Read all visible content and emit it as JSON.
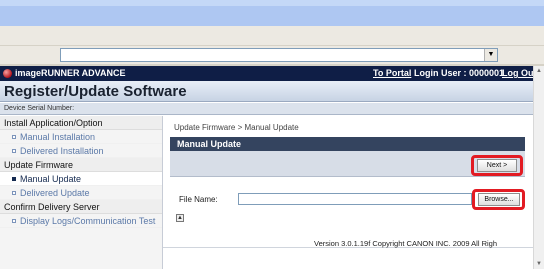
{
  "browser": {
    "address_value": "",
    "dropdown_glyph": "▼"
  },
  "app": {
    "name": "imageRUNNER ADVANCE",
    "to_portal": "To Portal",
    "login_user": "Login User : 0000001",
    "logout": "Log Out"
  },
  "header": {
    "title": "Register/Update Software",
    "serial_label": "Device Serial Number:"
  },
  "sidebar": {
    "sections": [
      {
        "label": "Install Application/Option",
        "items": [
          "Manual Installation",
          "Delivered Installation"
        ]
      },
      {
        "label": "Update Firmware",
        "items": [
          "Manual Update",
          "Delivered Update"
        ]
      },
      {
        "label": "Confirm Delivery Server",
        "items": [
          "Display Logs/Communication Test"
        ]
      }
    ],
    "active_item": "Manual Update"
  },
  "content": {
    "breadcrumb": "Update Firmware > Manual Update",
    "panel_title": "Manual Update",
    "next_button": "Next >",
    "file_label": "File Name:",
    "file_value": "",
    "browse_button": "Browse..."
  },
  "footer": {
    "text": "Version 3.0.1.19f Copyright CANON INC. 2009 All Righ"
  },
  "colors": {
    "app_bar": "#0f1e46",
    "highlight": "#e21b23",
    "panel_title": "#34445f"
  }
}
